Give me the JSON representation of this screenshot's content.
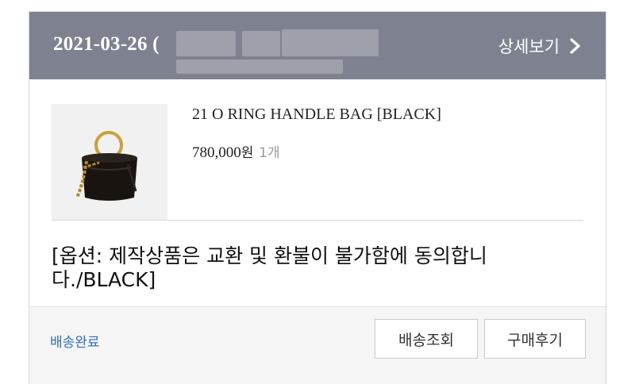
{
  "order": {
    "date": "2021-03-26 (",
    "detail_link": "상세보기",
    "detail_icon": "chevron-right-icon"
  },
  "item": {
    "name": "21 O RING HANDLE BAG [BLACK]",
    "price": "780,000",
    "price_unit": "원",
    "quantity": "1개",
    "image": "black-bucket-bag-thumbnail"
  },
  "option": {
    "text": "[옵션: 제작상품은 교환 및 환불이 불가함에 동의합니다./BLACK]"
  },
  "footer": {
    "status": "배송완료",
    "track_button": "배송조회",
    "review_button": "구매후기"
  },
  "colors": {
    "header_bg": "#7e8290",
    "status_blue": "#2f6fb6",
    "footer_bg": "#f5f5f5"
  }
}
